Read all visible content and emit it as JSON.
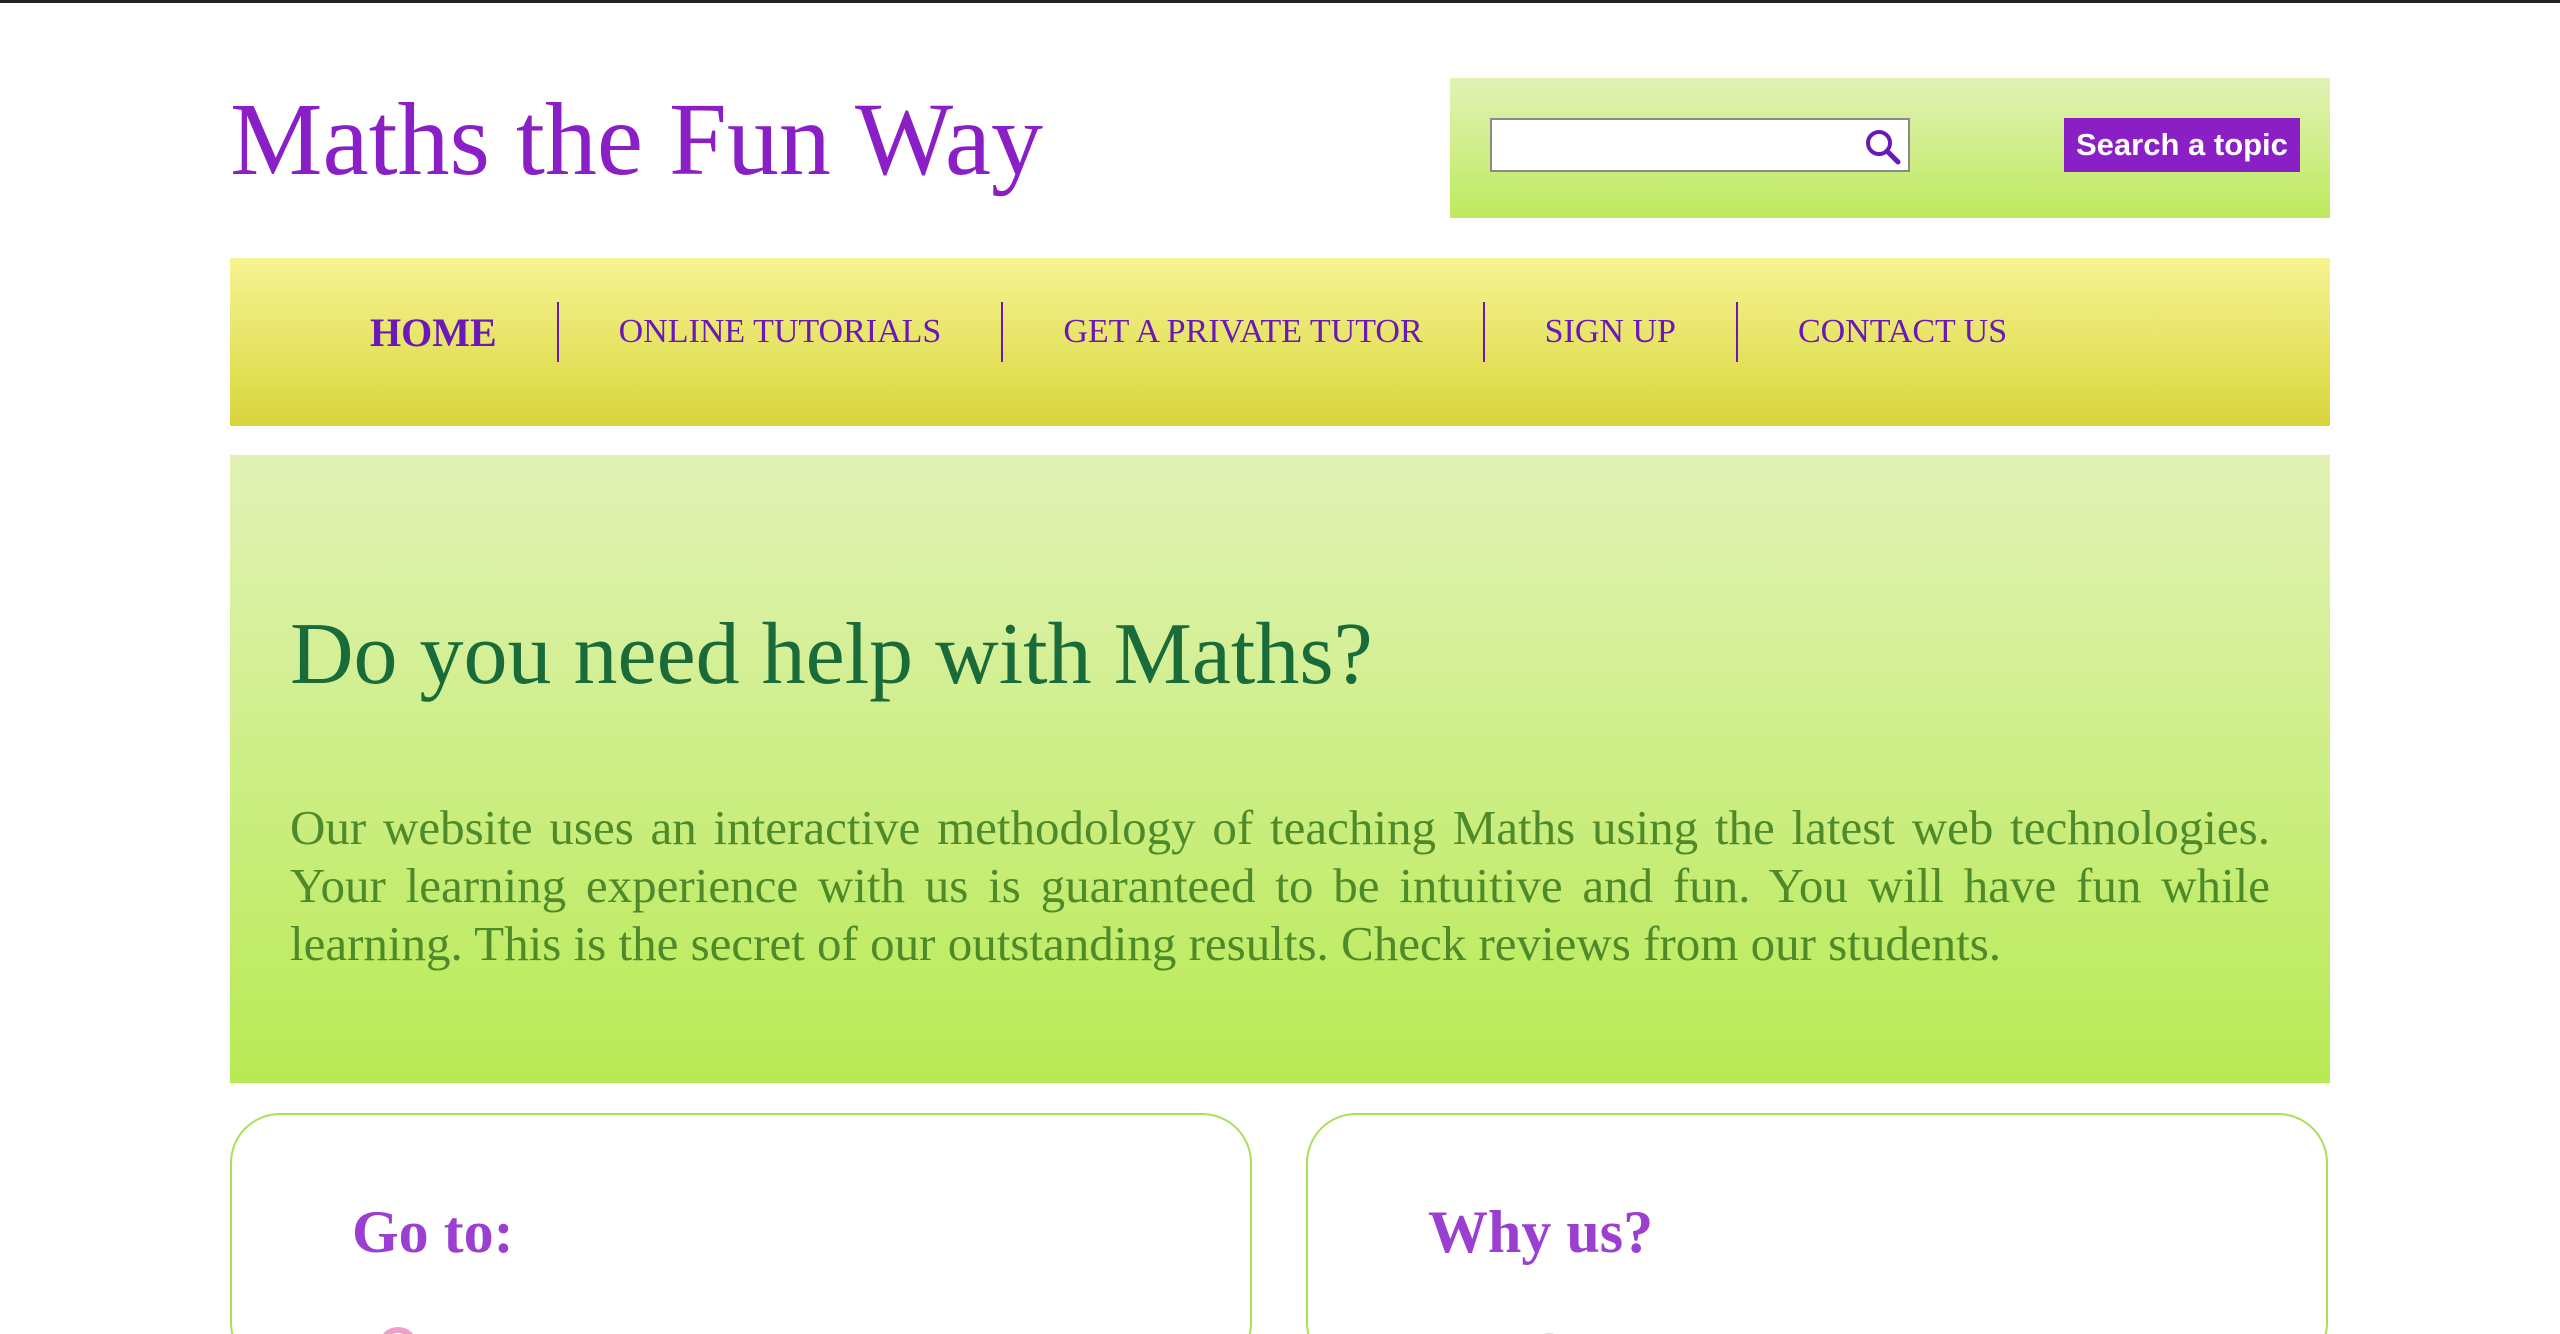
{
  "header": {
    "site_title": "Maths the Fun Way"
  },
  "search": {
    "placeholder": "",
    "value": "",
    "button_label": "Search a topic",
    "icon": "magnifier-icon"
  },
  "nav": {
    "items": [
      {
        "label": "HOME",
        "active": true
      },
      {
        "label": "ONLINE TUTORIALS",
        "active": false
      },
      {
        "label": "GET A PRIVATE TUTOR",
        "active": false
      },
      {
        "label": "SIGN UP",
        "active": false
      },
      {
        "label": "CONTACT US",
        "active": false
      }
    ]
  },
  "hero": {
    "heading": "Do you need help with Maths?",
    "text": "Our website uses an interactive methodology of teaching Maths using the latest web technologies. Your learning experience with us is guaranteed to be intuitive and fun. You will have fun while learning. This is the secret of our outstanding results. Check reviews from our students."
  },
  "cards": {
    "left": {
      "title": "Go to:"
    },
    "right": {
      "title": "Why us?"
    }
  },
  "colors": {
    "brand_purple": "#8a1fc6",
    "nav_yellow": "#d7d63a",
    "hero_green": "#b8ea54",
    "heading_green": "#1a6b3a"
  }
}
